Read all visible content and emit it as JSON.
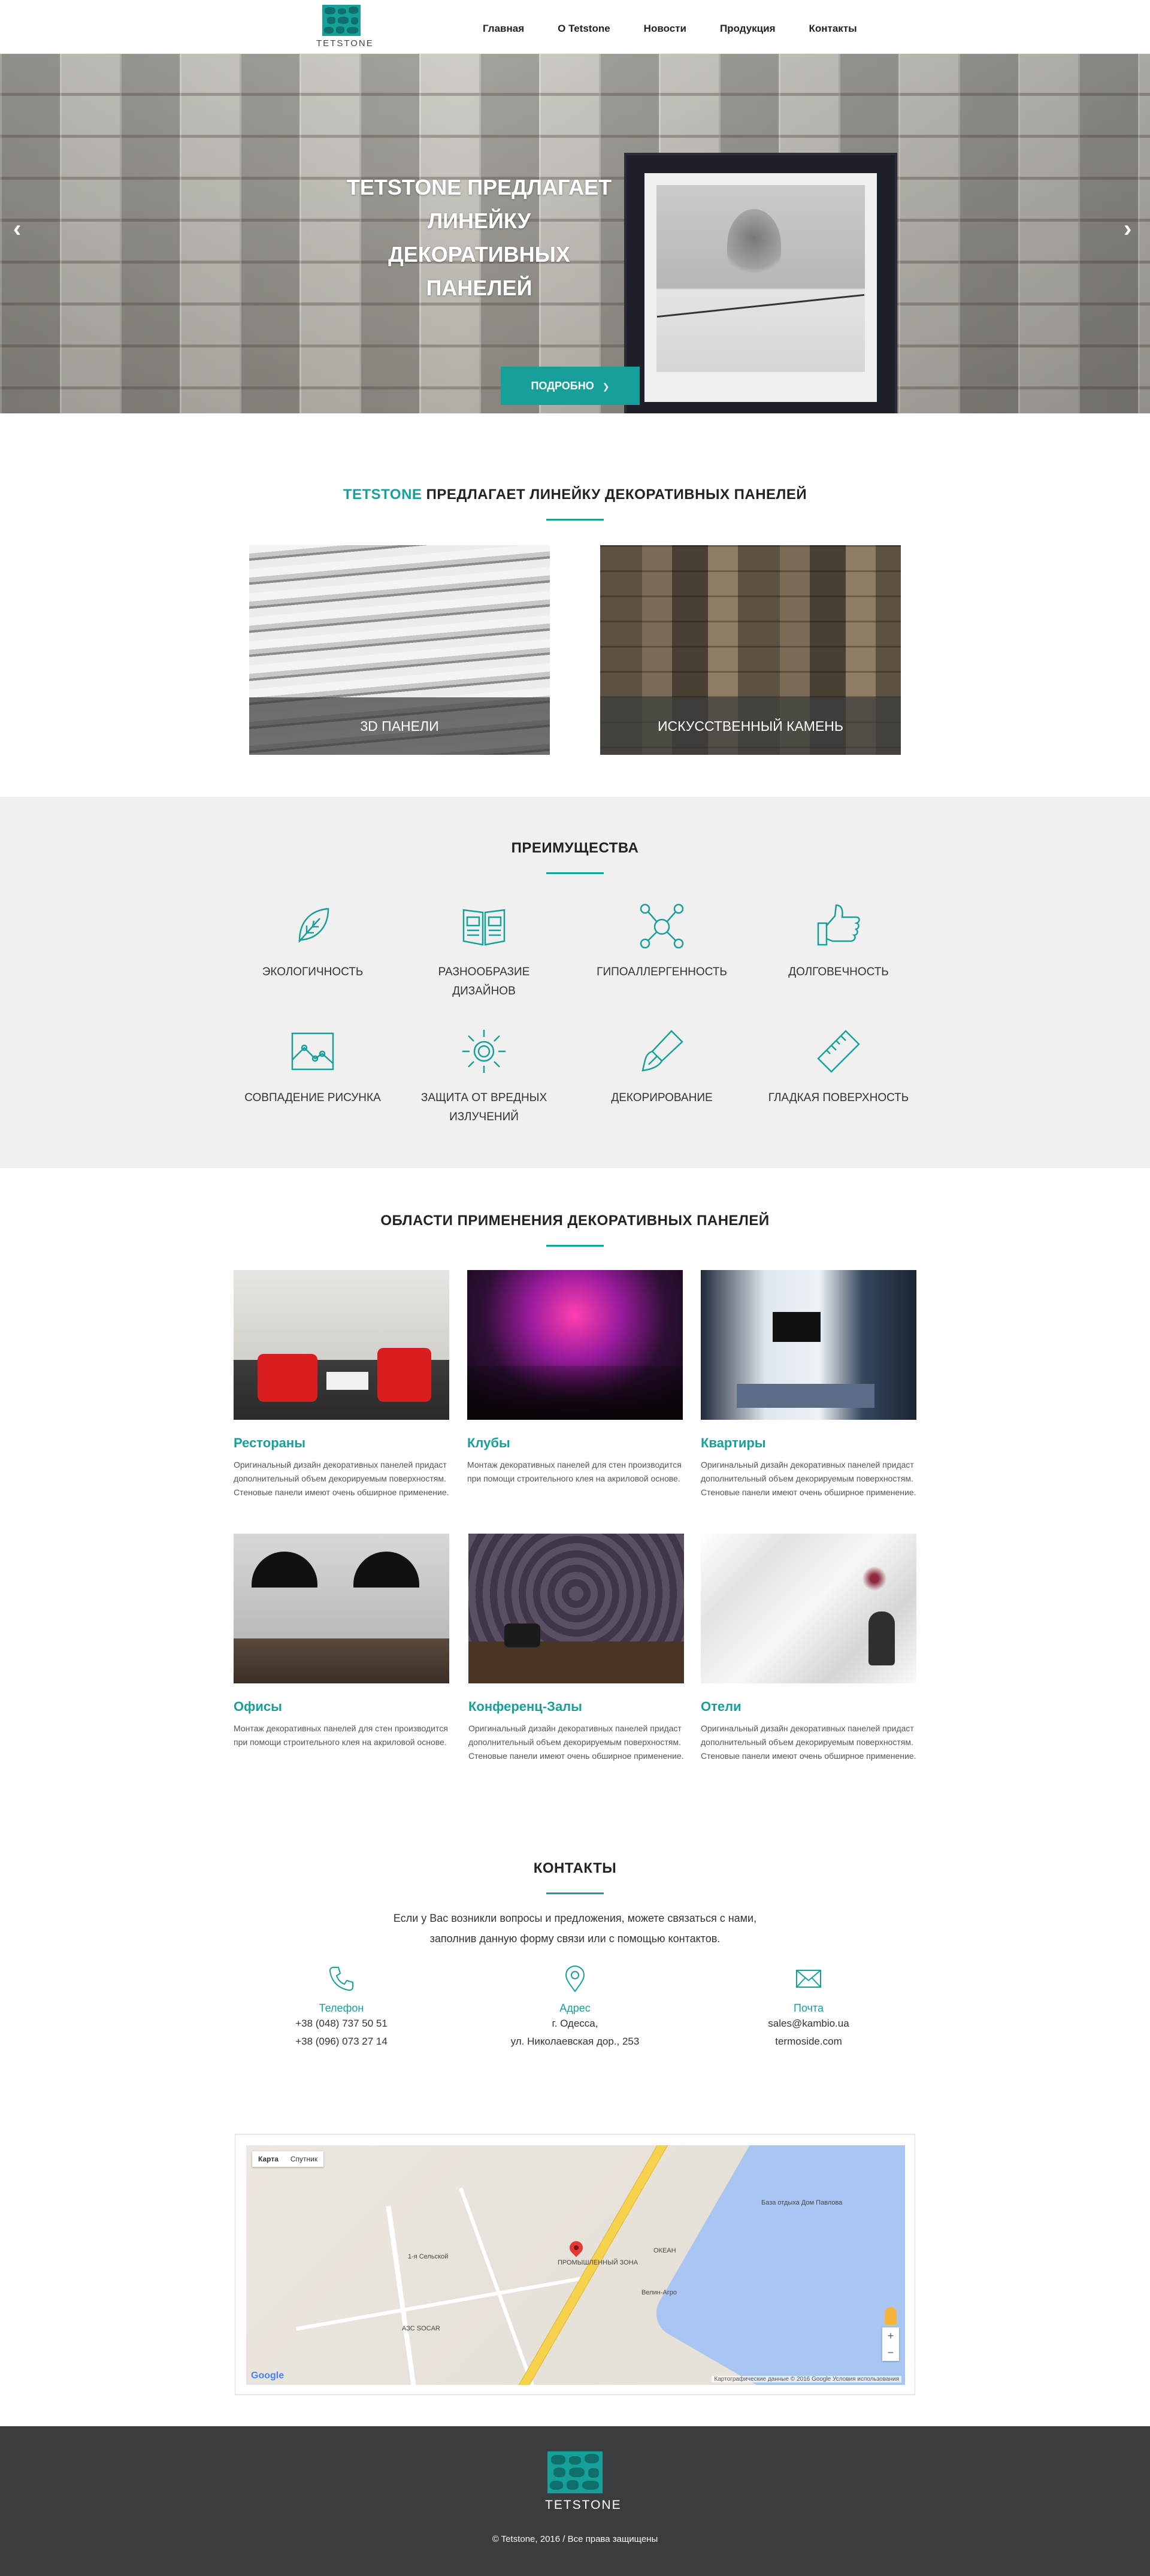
{
  "brand": {
    "name": "TETSTONE",
    "accent_color": "#17a09a",
    "footer_bg": "#3b3c3e"
  },
  "nav": {
    "items": [
      "Главная",
      "О Tetstone",
      "Новости",
      "Продукция",
      "Контакты"
    ]
  },
  "hero": {
    "title_line1": "TETSTONE ПРЕДЛАГАЕТ ЛИНЕЙКУ",
    "title_line2": "ДЕКОРАТИВНЫХ ПАНЕЛЕЙ",
    "button_label": "ПОДРОБНО",
    "prev_icon": "chevron-left-icon",
    "next_icon": "chevron-right-icon"
  },
  "products": {
    "title_accent": "TETSTONE",
    "title_rest": " ПРЕДЛАГАЕТ ЛИНЕЙКУ ДЕКОРАТИВНЫХ ПАНЕЛЕЙ",
    "items": [
      {
        "label": "3D ПАНЕЛИ"
      },
      {
        "label": "ИСКУССТВЕННЫЙ КАМЕНЬ"
      }
    ]
  },
  "advantages": {
    "title": "ПРЕИМУЩЕСТВА",
    "items": [
      {
        "label": "ЭКОЛОГИЧНОСТЬ",
        "icon": "leaf-icon"
      },
      {
        "label": "РАЗНООБРАЗИЕ ДИЗАЙНОВ",
        "icon": "book-icon"
      },
      {
        "label": "ГИПОАЛЛЕРГЕННОСТЬ",
        "icon": "molecule-icon"
      },
      {
        "label": "ДОЛГОВЕЧНОСТЬ",
        "icon": "thumbs-up-icon"
      },
      {
        "label": "СОВПАДЕНИЕ РИСУНКА",
        "icon": "picture-icon"
      },
      {
        "label": "ЗАЩИТА ОТ ВРЕДНЫХ ИЗЛУЧЕНИЙ",
        "icon": "sun-icon"
      },
      {
        "label": "ДЕКОРИРОВАНИЕ",
        "icon": "brush-icon"
      },
      {
        "label": "ГЛАДКАЯ ПОВЕРХНОСТЬ",
        "icon": "ruler-icon"
      }
    ]
  },
  "applications": {
    "title": "ОБЛАСТИ ПРИМЕНЕНИЯ ДЕКОРАТИВНЫХ ПАНЕЛЕЙ",
    "items": [
      {
        "title": "Рестораны",
        "text": "Оригинальный дизайн декоративных панелей придаст дополнительный объем декорируемым поверхностям. Стеновые панели имеют очень обширное применение."
      },
      {
        "title": "Клубы",
        "text": "Монтаж декоративных панелей для стен производится при помощи строительного клея на акриловой основе."
      },
      {
        "title": "Квартиры",
        "text": "Оригинальный дизайн декоративных панелей придаст дополнительный объем декорируемым поверхностям. Стеновые панели имеют очень обширное применение."
      },
      {
        "title": "Офисы",
        "text": "Монтаж декоративных панелей для стен производится при помощи строительного клея на акриловой основе."
      },
      {
        "title": "Конференц-Залы",
        "text": "Оригинальный дизайн декоративных панелей придаст дополнительный объем декорируемым поверхностям. Стеновые панели имеют очень обширное применение."
      },
      {
        "title": "Отели",
        "text": "Оригинальный дизайн декоративных панелей придаст дополнительный объем декорируемым поверхностям. Стеновые панели имеют очень обширное применение."
      }
    ]
  },
  "contacts": {
    "title": "КОНТАКТЫ",
    "intro_line1": "Если у Вас возникли вопросы и предложения, можете связаться с нами,",
    "intro_line2": "заполнив данную форму связи или с помощью контактов.",
    "phone": {
      "title": "Телефон",
      "lines": [
        "+38 (048) 737 50 51",
        "+38 (096) 073 27 14"
      ],
      "icon": "phone-icon"
    },
    "address": {
      "title": "Адрес",
      "lines": [
        "г. Одесса,",
        "ул. Николаевская дор., 253"
      ],
      "icon": "map-pin-icon"
    },
    "mail": {
      "title": "Почта",
      "lines": [
        "sales@kambio.ua",
        "termoside.com"
      ],
      "icon": "envelope-icon"
    }
  },
  "map": {
    "tab_map": "Карта",
    "tab_satellite": "Спутник",
    "google": "Google",
    "attribution": "Картографические данные © 2016 Google   Условия использования",
    "zoom_in": "+",
    "zoom_out": "−",
    "labels": [
      "1-я Сельской",
      "АЗС SOCAR",
      "ОКЕАН",
      "База отдыха Дом Павлова",
      "ПРОМЫШЛЕННЫЙ ЗОНА",
      "Велин-Агро"
    ]
  },
  "footer": {
    "logo_text": "TETSTONE",
    "copyright": "© Tetstone, 2016 / Все права защищены"
  }
}
